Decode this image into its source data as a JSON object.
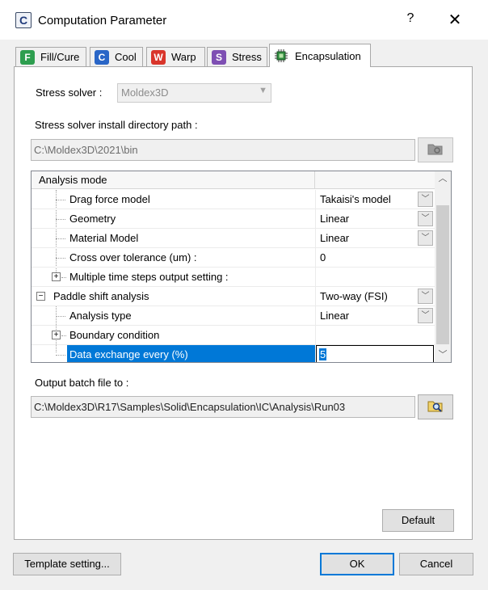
{
  "window": {
    "title": "Computation Parameter",
    "help": "?",
    "close": "✕"
  },
  "tabs": [
    {
      "label": "Fill/Cure",
      "badge": "F",
      "color": "#2e9e4f"
    },
    {
      "label": "Cool",
      "badge": "C",
      "color": "#2a66c7"
    },
    {
      "label": "Warp",
      "badge": "W",
      "color": "#d9352b"
    },
    {
      "label": "Stress",
      "badge": "S",
      "color": "#7e4fb3"
    },
    {
      "label": "Encapsulation",
      "badge": "",
      "color": "#2e8b3e"
    }
  ],
  "stress_solver": {
    "label": "Stress solver :",
    "value": "Moldex3D"
  },
  "install_dir": {
    "label": "Stress solver install directory path :",
    "value": "C:\\Moldex3D\\2021\\bin"
  },
  "grid": {
    "header": "Analysis mode",
    "rows": [
      {
        "name": "Drag force model",
        "value": "Takaisi's model",
        "dropdown": true
      },
      {
        "name": "Geometry",
        "value": "Linear",
        "dropdown": true
      },
      {
        "name": "Material Model",
        "value": "Linear",
        "dropdown": true
      },
      {
        "name": "Cross over tolerance (um) :",
        "value": "0",
        "dropdown": false
      },
      {
        "name": "Multiple time steps output setting :",
        "value": "",
        "dropdown": false
      },
      {
        "name": "Paddle shift analysis",
        "value": "Two-way (FSI)",
        "dropdown": true
      },
      {
        "name": "Analysis type",
        "value": "Linear",
        "dropdown": true
      },
      {
        "name": "Boundary condition",
        "value": "",
        "dropdown": false
      },
      {
        "name": "Data exchange every (%)",
        "value": "5",
        "dropdown": false
      }
    ]
  },
  "output": {
    "label": "Output batch file to :",
    "value": "C:\\Moldex3D\\R17\\Samples\\Solid\\Encapsulation\\IC\\Analysis\\Run03"
  },
  "buttons": {
    "default": "Default",
    "template": "Template setting...",
    "ok": "OK",
    "cancel": "Cancel"
  }
}
